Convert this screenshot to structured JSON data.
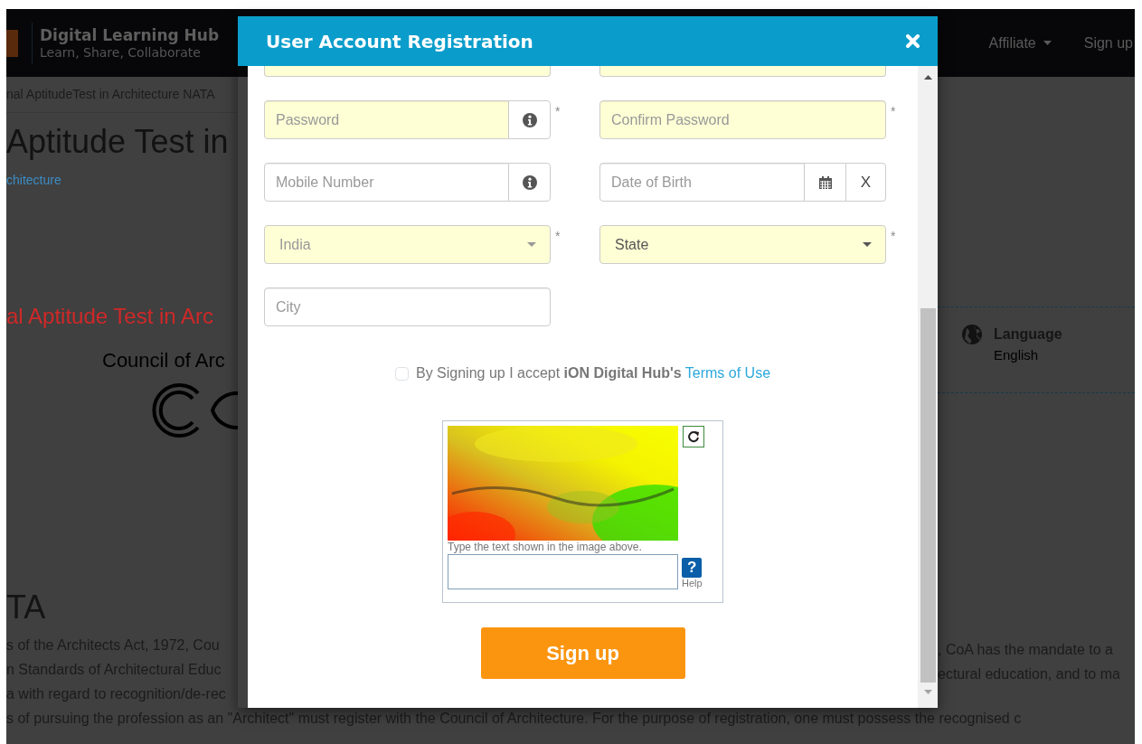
{
  "header": {
    "brand_title": "Digital Learning Hub",
    "brand_tagline": "Learn, Share, Collaborate",
    "nav": [
      {
        "label": "Affiliate",
        "dropdown": true
      },
      {
        "label": "Sign up",
        "dropdown": false
      }
    ]
  },
  "page": {
    "breadcrumb": "nal AptitudeTest in Architecture NATA",
    "title": "Aptitude Test in",
    "link": "chitecture",
    "subtitle": "al Aptitude Test in Arc",
    "org": "Council of Arc",
    "language": {
      "label": "Language",
      "value": "English"
    },
    "heading": "TA",
    "para_left": [
      "s of the Architects Act, 1972, Cou",
      "n Standards of Architectural Educ",
      "a with regard to recognition/de-rec"
    ],
    "para_right": [
      ", CoA has the mandate to a",
      "ectural education, and to ma"
    ],
    "para_full": "s of pursuing the profession as an \"Architect\" must register with the Council of Architecture. For the purpose of registration, one must possess the recognised c"
  },
  "modal": {
    "title": "User Account Registration",
    "rows": [
      [
        {
          "kind": "cut",
          "required": true
        },
        {
          "kind": "cut",
          "required": true
        }
      ],
      [
        {
          "kind": "text",
          "placeholder": "Password",
          "required": true,
          "mark": "*",
          "addons": [
            {
              "kind": "info"
            }
          ]
        },
        {
          "kind": "text",
          "placeholder": "Confirm Password",
          "required": true,
          "mark": "*"
        }
      ],
      [
        {
          "kind": "text",
          "placeholder": "Mobile Number",
          "required": false,
          "addons": [
            {
              "kind": "info"
            }
          ]
        },
        {
          "kind": "text",
          "placeholder": "Date of Birth",
          "required": false,
          "addons": [
            {
              "kind": "calendar"
            },
            {
              "kind": "button",
              "label": "X"
            }
          ]
        }
      ],
      [
        {
          "kind": "select",
          "value": "India",
          "disabled": true,
          "required": true,
          "mark": "*"
        },
        {
          "kind": "select",
          "value": "State",
          "disabled": false,
          "required": true,
          "mark": "*"
        }
      ],
      [
        {
          "kind": "text",
          "placeholder": "City",
          "required": false
        }
      ]
    ],
    "terms": {
      "checked": false,
      "text": "By Signing up I accept **iON Digital Hub's**",
      "link": "Terms of Use"
    },
    "captcha": {
      "caption": "Type the text shown in the image above.",
      "help_mark": "?",
      "help": "Help"
    },
    "submit": "Sign up"
  }
}
